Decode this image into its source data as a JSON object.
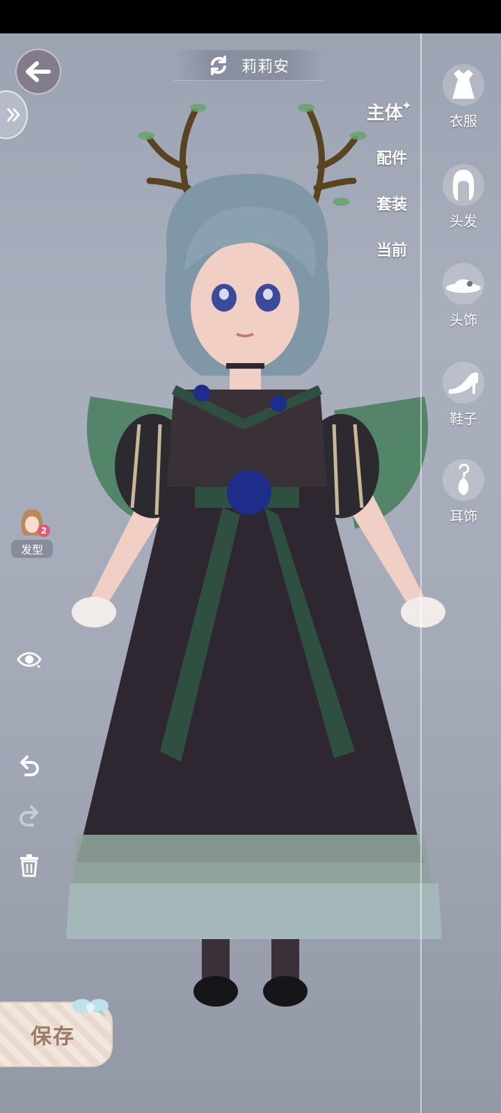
{
  "header": {
    "character_name": "莉莉安",
    "back_icon": "arrow-left-icon",
    "swap_icon": "swap-icon",
    "expand_icon": "double-chevron-right-icon"
  },
  "categories": {
    "main": "主体",
    "accessories": "配件",
    "sets": "套装",
    "current": "当前"
  },
  "side_menu": [
    {
      "label": "衣服",
      "icon": "dress-icon"
    },
    {
      "label": "头发",
      "icon": "hair-icon"
    },
    {
      "label": "头饰",
      "icon": "hat-icon"
    },
    {
      "label": "鞋子",
      "icon": "high-heel-icon"
    },
    {
      "label": "耳饰",
      "icon": "earring-icon"
    }
  ],
  "left_tools": {
    "hair_style_label": "发型",
    "hair_style_count": "2",
    "visibility_icon": "eye-icon",
    "undo_icon": "undo-icon",
    "redo_icon": "redo-icon",
    "delete_icon": "trash-icon"
  },
  "save_button": {
    "label": "保存"
  },
  "colors": {
    "accent": "#e05a75",
    "save_text": "#9b7a66",
    "save_bg": "#f2e7de",
    "dress_dark": "#2e2630",
    "dress_green": "#2f5040",
    "hair": "#7f97a6"
  }
}
